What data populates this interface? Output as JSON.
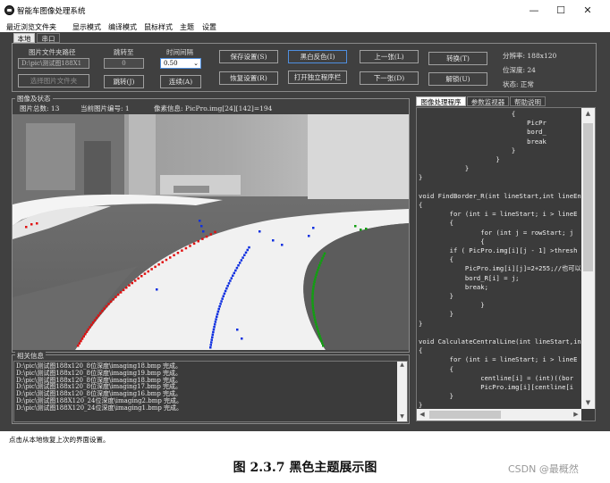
{
  "window": {
    "title": "智能车图像处理系统",
    "minimize": "—",
    "maximize": "☐",
    "close": "✕"
  },
  "menu": [
    "最近浏览文件夹",
    "显示模式",
    "编译模式",
    "鼠标样式",
    "主题",
    "设置"
  ],
  "top_tabs": [
    "本地",
    "串口"
  ],
  "controls": {
    "folder_label": "图片文件夹路径",
    "folder_path": "D:\\pic\\测试图188X1",
    "select_button": "选择图片文件夹",
    "jump_label": "跳转至",
    "jump_value": "0",
    "jump_button": "跳转(J)",
    "interval_label": "时间间隔",
    "interval_value": "0.50",
    "continuous_button": "连续(A)",
    "save_settings": "保存设置(S)",
    "restore_settings": "恢复设置(R)",
    "invert_bw": "黑白反色(I)",
    "open_editor": "打开独立程序栏",
    "prev_image": "上一张(L)",
    "next_image": "下一张(D)",
    "convert": "转换(T)",
    "unlock": "解锁(U)"
  },
  "image_info": {
    "resolution": "分辨率: 188x120",
    "bit_depth": "位深度: 24",
    "state": "状态: 正常"
  },
  "image_status": {
    "group_label": "图像及状态",
    "total": "图片总数: 13",
    "current": "当前图片编号: 1",
    "pixel": "像素信息: PicPro.img[24][142]=194"
  },
  "right_tabs": [
    "图像处理程序",
    "参数监视器",
    "帮助说明"
  ],
  "code_lines": [
    "                        {",
    "                            PicPr",
    "                            bord_",
    "                            break",
    "                        }",
    "                    }",
    "            }",
    "}",
    "",
    "void FindBorder_R(int lineStart,int lineEn",
    "{",
    "        for (int i = lineStart; i > lineE",
    "        {",
    "                for (int j = rowStart; j",
    "                {",
    "        if ( PicPro.img[i][j - 1] >thresh",
    "        {",
    "            PicPro.img[i][j]=2+255;//也可以",
    "            bord_R[i] = j;",
    "            break;",
    "        }",
    "                }",
    "        }",
    "}",
    "",
    "void CalculateCentralLine(int lineStart,in",
    "{",
    "        for (int i = lineStart; i > lineE",
    "        {",
    "                centline[i] = (int)((bor",
    "                PicPro.img[i][centline[i",
    "        }",
    "}"
  ],
  "log": {
    "label": "相关信息",
    "lines": [
      "D:\\pic\\测试图188x120_8位深度\\imaging18.bmp 完成。",
      "D:\\pic\\测试图188x120_8位深度\\imaging19.bmp 完成。",
      "D:\\pic\\测试图188x120_8位深度\\imaging18.bmp 完成。",
      "D:\\pic\\测试图188x120_8位深度\\imaging17.bmp 完成。",
      "D:\\pic\\测试图188x120_8位深度\\imaging16.bmp 完成。",
      "D:\\pic\\测试图188X120_24位深度\\imaging2.bmp 完成。",
      "D:\\pic\\测试图188X120_24位深度\\imaging1.bmp 完成。"
    ]
  },
  "status_bar": "点击从本地恢复上次的界面设置。",
  "caption": "图 2.3.7 黑色主题展示图",
  "watermark": "CSDN @最概然",
  "colors": {
    "theme_bg": "#404040",
    "left_border": "#e01010",
    "right_border": "#10a010",
    "center_line": "#1030e0"
  }
}
